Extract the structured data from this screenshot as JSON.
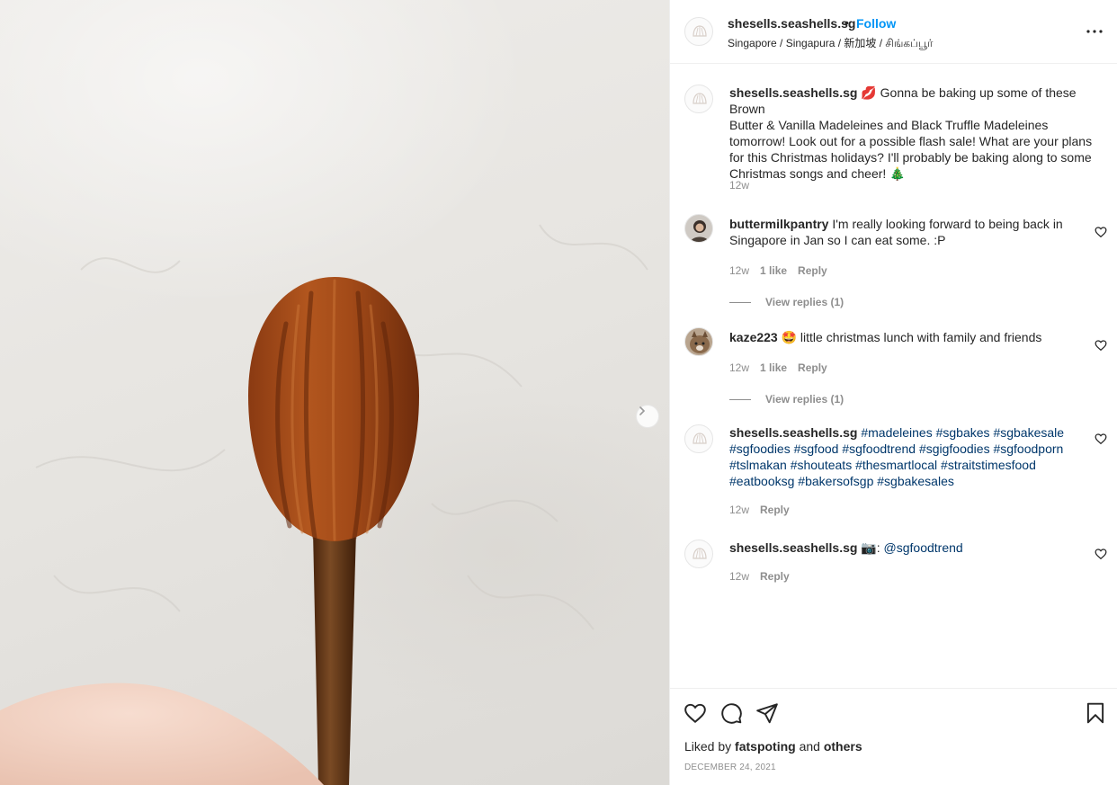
{
  "post": {
    "username": "shesells.seashells.sg",
    "dot": "•",
    "follow_label": "Follow",
    "location": "Singapore / Singapura / 新加坡 / சிங்கப்பூர்"
  },
  "comments": [
    {
      "username": "shesells.seashells.sg",
      "emoji": "💋",
      "lines": [
        "Gonna be baking up some of these Brown",
        "Butter & Vanilla Madeleines and Black Truffle Madeleines",
        "tomorrow! Look out for a possible flash sale! What are your plans",
        "for this Christmas holidays? I'll probably be baking along to some",
        "Christmas songs and cheer! 🎄"
      ],
      "time": "12w"
    },
    {
      "username": "buttermilkpantry",
      "lines": [
        "I'm really looking forward to being back in",
        "Singapore in Jan so I can eat some. :P"
      ],
      "time": "12w",
      "likes": "1 like",
      "reply": "Reply",
      "view_replies": "View replies (1)"
    },
    {
      "username": "kaze223",
      "text": "🤩 little christmas lunch with family and friends",
      "time": "12w",
      "likes": "1 like",
      "reply": "Reply",
      "view_replies": "View replies (1)"
    },
    {
      "username": "shesells.seashells.sg",
      "tags_lines": [
        [
          "#madeleines",
          "#sgbakes",
          "#sgbakesale"
        ],
        [
          "#sgfoodies",
          "#sgfood",
          "#sgfoodtrend",
          "#sgigfoodies",
          "#sgfoodporn"
        ],
        [
          "#tslmakan",
          "#shouteats",
          "#thesmartlocal",
          "#straitstimesfood"
        ],
        [
          "#eatbooksg",
          "#bakersofsgp",
          "#sgbakesales"
        ]
      ],
      "time": "12w",
      "reply": "Reply"
    },
    {
      "username": "shesells.seashells.sg",
      "prefix": "📷: ",
      "mention": "@sgfoodtrend",
      "time": "12w",
      "reply": "Reply"
    }
  ],
  "footer": {
    "liked_by_prefix": "Liked by",
    "liked_by_user": "fatspoting",
    "liked_by_and": "and",
    "liked_by_others": "others",
    "date": "DECEMBER 24, 2021"
  },
  "icons": {
    "like": "heart-icon",
    "comment": "comment-bubble-icon",
    "share": "paper-plane-icon",
    "save": "bookmark-icon",
    "more": "more-options-icon",
    "next": "chevron-right-icon"
  },
  "colors": {
    "link_blue": "#0095f6",
    "hashtag": "#00376b",
    "muted": "#8e8e8e",
    "text": "#262626"
  }
}
